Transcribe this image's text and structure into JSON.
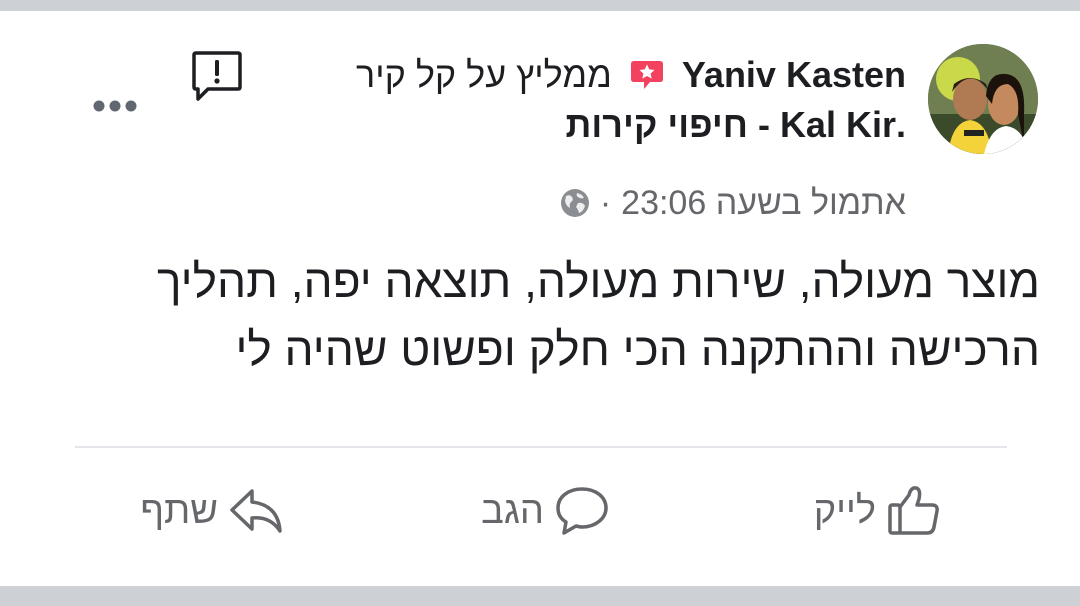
{
  "post": {
    "author": "Yaniv Kasten",
    "recommend_text": "ממליץ על קל קיר",
    "page_name": ".Kal Kir - חיפוי קירות",
    "timestamp": "אתמול בשעה 23:06",
    "separator": "·",
    "body": "מוצר מעולה, שירות מעולה, תוצאה יפה, תהליך הרכישה וההתקנה הכי חלק ופשוט שהיה לי"
  },
  "actions": {
    "like": "לייק",
    "comment": "הגב",
    "share": "שתף"
  },
  "icons": {
    "recommend": "recommend-star-icon",
    "globe": "globe-icon",
    "report": "report-icon",
    "more": "more-options-icon"
  },
  "colors": {
    "recommend_red": "#f3425f",
    "text": "#1c1e21",
    "secondary": "#65676b",
    "divider": "#e4e6eb",
    "background": "#cdd0d4"
  }
}
